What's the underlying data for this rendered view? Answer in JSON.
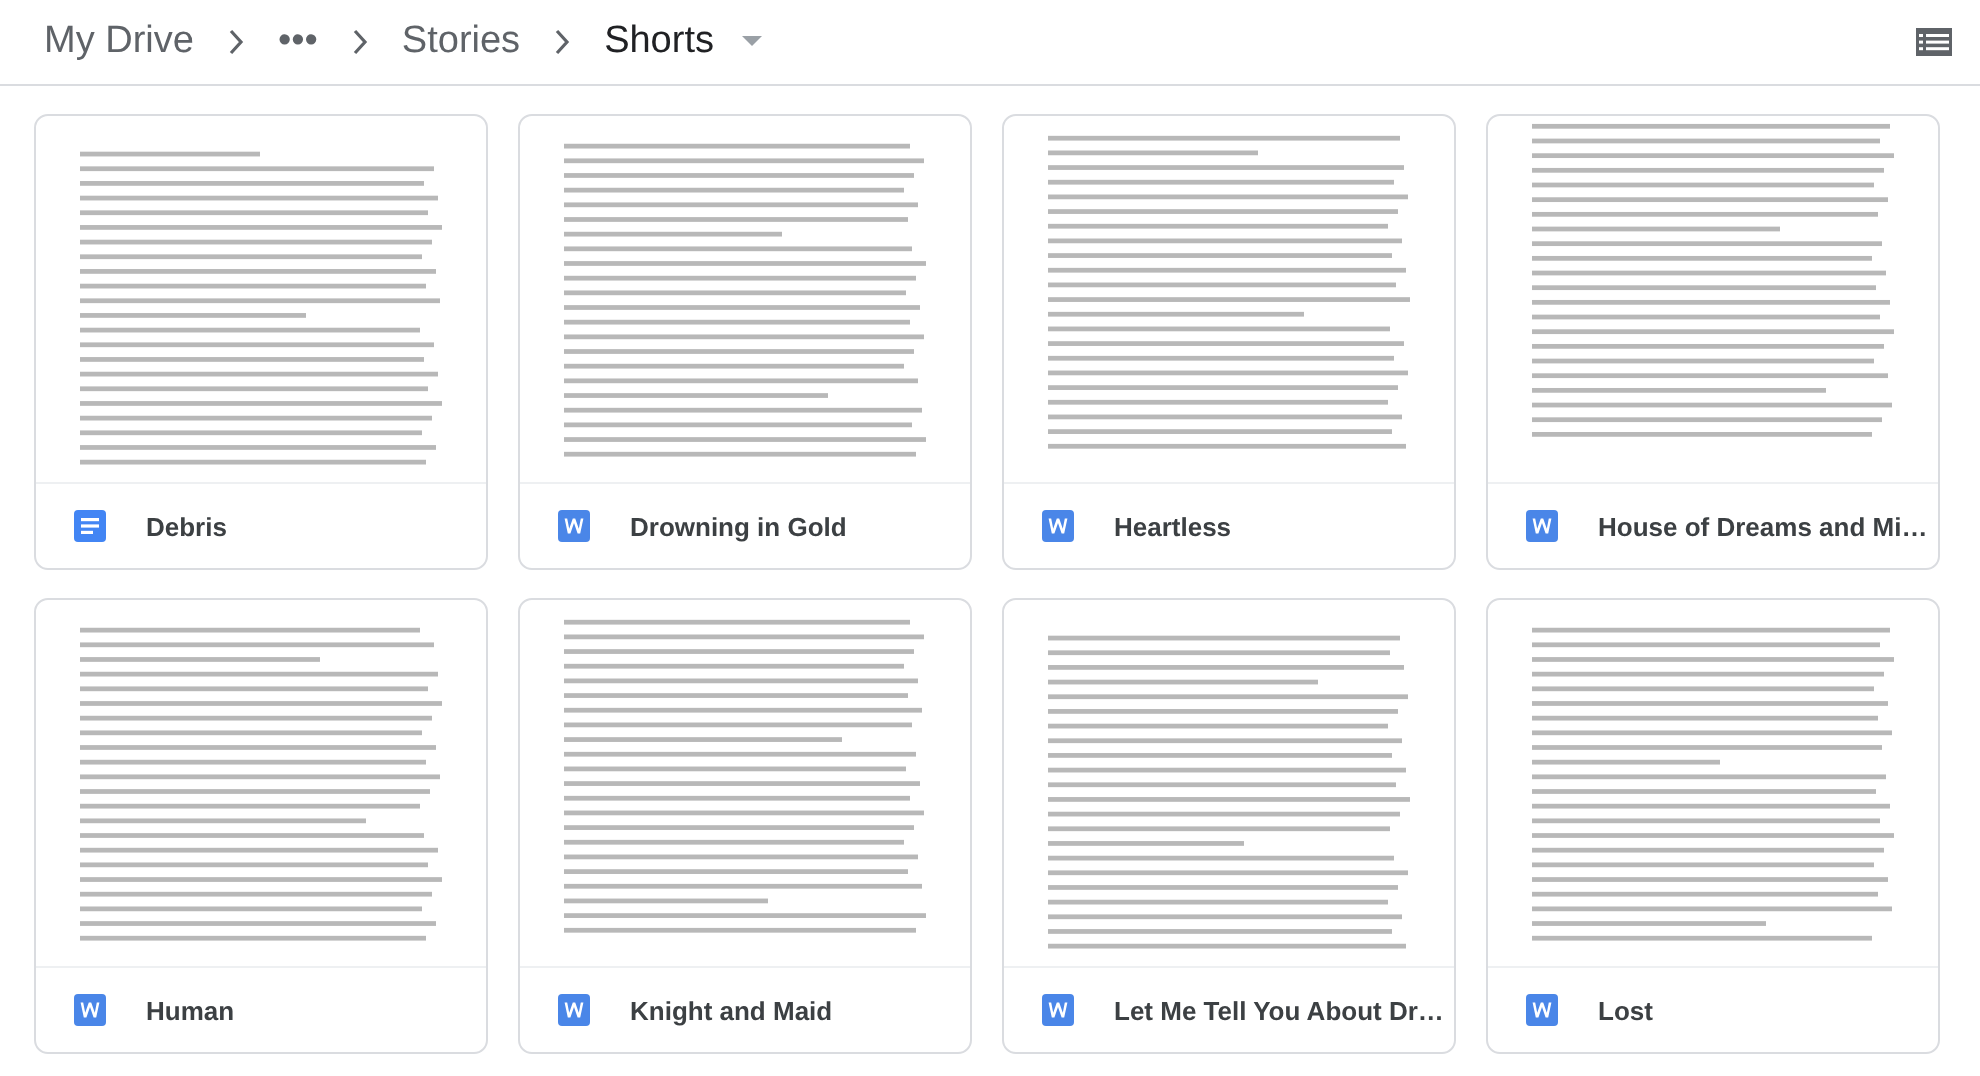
{
  "breadcrumb": [
    {
      "label": "My Drive",
      "menu": false
    },
    {
      "label": "•••",
      "menu": false
    },
    {
      "label": "Stories",
      "menu": false
    },
    {
      "label": "Shorts",
      "menu": true
    }
  ],
  "files": [
    {
      "name": "Debris",
      "kind": "docs"
    },
    {
      "name": "Drowning in Gold",
      "kind": "word"
    },
    {
      "name": "Heartless",
      "kind": "word"
    },
    {
      "name": "House of Dreams and Mi…",
      "kind": "word"
    },
    {
      "name": "Human",
      "kind": "word"
    },
    {
      "name": "Knight and Maid",
      "kind": "word"
    },
    {
      "name": "Let Me Tell You About Dr…",
      "kind": "word"
    },
    {
      "name": "Lost",
      "kind": "word"
    }
  ]
}
